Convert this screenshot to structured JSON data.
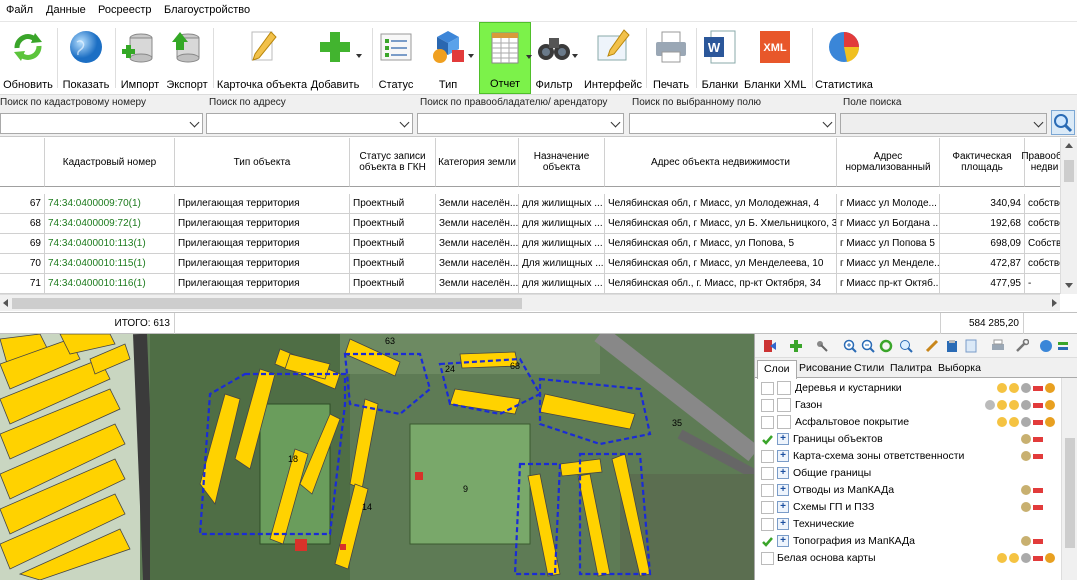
{
  "menu": [
    "Файл",
    "Данные",
    "Росреестр",
    "Благоустройство"
  ],
  "toolbar": {
    "refresh": "Обновить",
    "show": "Показать",
    "import": "Импорт",
    "export": "Экспорт",
    "card": "Карточка объекта",
    "add": "Добавить",
    "status": "Статус",
    "type": "Тип",
    "report": "Отчет",
    "filter": "Фильтр",
    "interface": "Интерфейс",
    "print": "Печать",
    "forms": "Бланки",
    "forms_xml": "Бланки XML",
    "stats": "Статистика",
    "xml_icon_text": "XML",
    "word_icon_text": "W"
  },
  "search": {
    "cadastral": "Поиск по кадастровому номеру",
    "address": "Поиск по адресу",
    "owner": "Поиск по правообладателю/ арендатору",
    "field": "Поиск по выбранному полю",
    "search_field": "Поле поиска"
  },
  "grid": {
    "headers": [
      "Кадастровый номер",
      "Тип объекта",
      "Статус записи объекта в ГКН",
      "Категория земли",
      "Назначение объекта",
      "Адрес объекта недвижимости",
      "Адрес нормализованный",
      "Фактическая площадь",
      "Правообъ недви"
    ],
    "rows": [
      {
        "n": "67",
        "cad": "74:34:0400009:70(1)",
        "type": "Прилегающая территория",
        "status": "Проектный",
        "cat": "Земли населён...",
        "purp": "для жилищных ...",
        "addr": "Челябинская обл, г Миасс, ул Молодежная, 4",
        "norm": "г Миасс ул Молоде...",
        "area": "340,94",
        "right": "собстве"
      },
      {
        "n": "68",
        "cad": "74:34:0400009:72(1)",
        "type": "Прилегающая территория",
        "status": "Проектный",
        "cat": "Земли населён...",
        "purp": "для жилищных ...",
        "addr": "Челябинская обл, г Миасс, ул Б. Хмельницкого, 34",
        "norm": "г Миасс ул Богдана ...",
        "area": "192,68",
        "right": "собстве"
      },
      {
        "n": "69",
        "cad": "74:34:0400010:113(1)",
        "type": "Прилегающая территория",
        "status": "Проектный",
        "cat": "Земли населён...",
        "purp": "для жилищных ...",
        "addr": "Челябинская обл, г Миасс, ул Попова, 5",
        "norm": "г Миасс ул Попова 5",
        "area": "698,09",
        "right": "Собстве"
      },
      {
        "n": "70",
        "cad": "74:34:0400010:115(1)",
        "type": "Прилегающая территория",
        "status": "Проектный",
        "cat": "Земли населён...",
        "purp": "Для жилищных ...",
        "addr": "Челябинская обл, г Миасс, ул Менделеева, 10",
        "norm": "г Миасс ул Менделе...",
        "area": "472,87",
        "right": "собстве"
      },
      {
        "n": "71",
        "cad": "74:34:0400010:116(1)",
        "type": "Прилегающая территория",
        "status": "Проектный",
        "cat": "Земли населён...",
        "purp": "для жилищных ...",
        "addr": "Челябинская обл., г. Миасс, пр-кт Октября, 34",
        "norm": "г Миасс пр-кт Октяб...",
        "area": "477,95",
        "right": "-"
      }
    ],
    "total_label": "ИТОГО: 613",
    "total_area": "584 285,20"
  },
  "map": {
    "labels": [
      "63",
      "24",
      "68",
      "35",
      "14",
      "9",
      "18"
    ]
  },
  "panel": {
    "tabs": [
      "Слои",
      "Рисование",
      "Стили",
      "Палитра",
      "Выборка"
    ],
    "layers": [
      {
        "name": "Деревья и кустарники",
        "checked": false,
        "expand": false,
        "indent": true
      },
      {
        "name": "Газон",
        "checked": false,
        "expand": false,
        "indent": true
      },
      {
        "name": "Асфальтовое покрытие",
        "checked": false,
        "expand": false,
        "indent": true
      },
      {
        "name": "Границы объектов",
        "checked": true,
        "expand": true,
        "indent": false
      },
      {
        "name": "Карта-схема зоны ответственности",
        "checked": false,
        "expand": true,
        "indent": false
      },
      {
        "name": "Общие границы",
        "checked": false,
        "expand": true,
        "indent": false
      },
      {
        "name": "Отводы из МапКАДа",
        "checked": false,
        "expand": true,
        "indent": false
      },
      {
        "name": "Схемы ГП и ПЗЗ",
        "checked": false,
        "expand": true,
        "indent": false
      },
      {
        "name": "Технические",
        "checked": false,
        "expand": true,
        "indent": false
      },
      {
        "name": "Топография из МапКАДа",
        "checked": true,
        "expand": true,
        "indent": false
      },
      {
        "name": "Белая основа карты",
        "checked": false,
        "expand": false,
        "indent": false
      }
    ]
  },
  "colors": {
    "active_button": "#7cf24a",
    "cad_text": "#1e7b1e",
    "building": "#ffd200",
    "boundary": "#1a2bd6"
  }
}
